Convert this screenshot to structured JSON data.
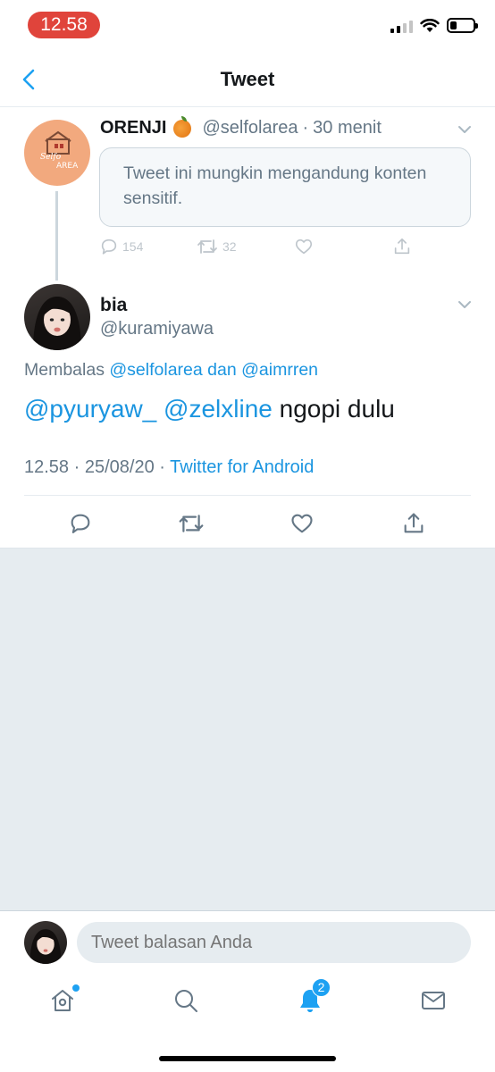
{
  "status_bar": {
    "time": "12.58",
    "battery_level": 0.3
  },
  "nav": {
    "title": "Tweet",
    "back_icon": "chevron-left-icon"
  },
  "parent_tweet": {
    "name": "ORENJI",
    "emoji": "orange-emoji",
    "handle": "@selfolarea",
    "separator": "·",
    "time": "30 menit",
    "notice": "Tweet ini mungkin mengandung konten sensitif.",
    "reply_count": "154",
    "retweet_count": "32"
  },
  "tweet": {
    "name": "bia",
    "handle": "@kuramiyawa",
    "reply_prefix": "Membalas",
    "reply_user1": "@selfolarea",
    "reply_joiner": "dan",
    "reply_user2": "@aimrren",
    "mention1": "@pyuryaw_",
    "mention2": "@zelxline",
    "body": "ngopi dulu",
    "time": "12.58",
    "date": "25/08/20",
    "sep": "·",
    "client": "Twitter for Android"
  },
  "reply_bar": {
    "placeholder": "Tweet balasan Anda"
  },
  "tab_bar": {
    "notifications_badge": "2"
  },
  "colors": {
    "accent": "#1da1f2",
    "link": "#1b95e0",
    "muted": "#657786",
    "time_pill": "#e0443b"
  }
}
